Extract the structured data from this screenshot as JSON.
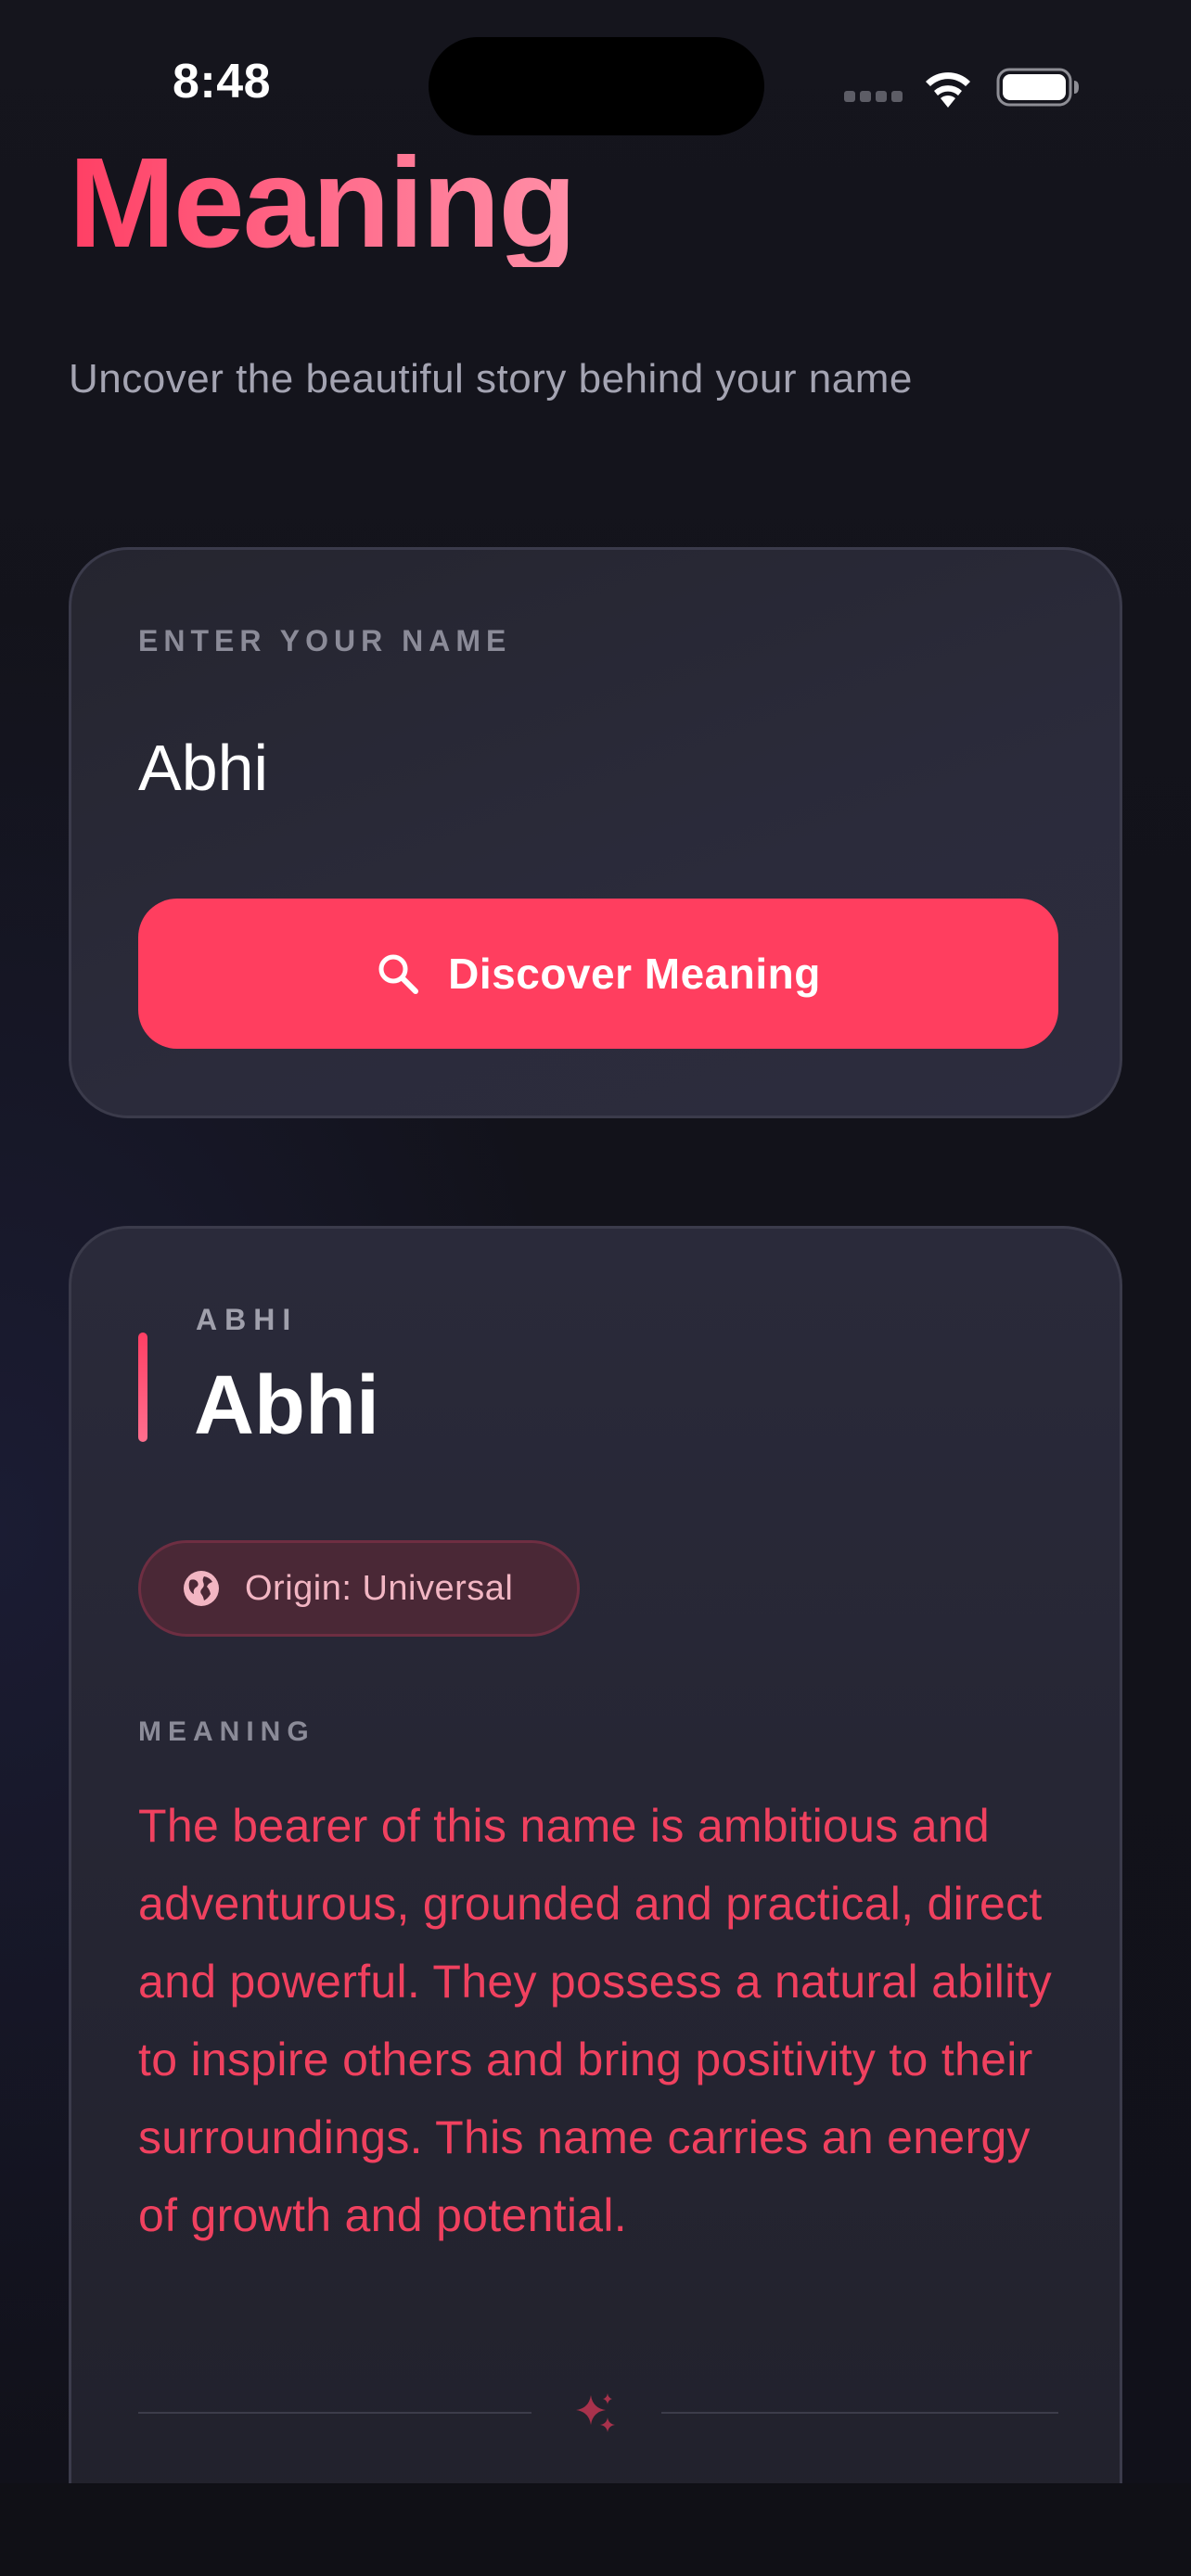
{
  "status_bar": {
    "time": "8:48"
  },
  "hero": {
    "title": "Meaning",
    "subtitle": "Uncover the beautiful story behind your name"
  },
  "input_card": {
    "label": "ENTER YOUR NAME",
    "value": "Abhi",
    "placeholder": "",
    "button_label": "Discover Meaning",
    "button_icon": "search-icon"
  },
  "result": {
    "small_name": "ABHI",
    "name": "Abhi",
    "origin": "Origin: Universal",
    "origin_icon": "globe-icon",
    "meaning_label": "MEANING",
    "meaning_text": "The bearer of this name is ambitious and adventurous, grounded and practical, direct and powerful. They possess a natural ability to inspire others and bring positivity to their surroundings. This name carries an energy of growth and potential.",
    "divider_icon": "sparkle-icon"
  },
  "colors": {
    "accent": "#ff3e5f",
    "background": "#12121a",
    "card": "#2a2a3a",
    "meaning_text": "#f0415f"
  }
}
